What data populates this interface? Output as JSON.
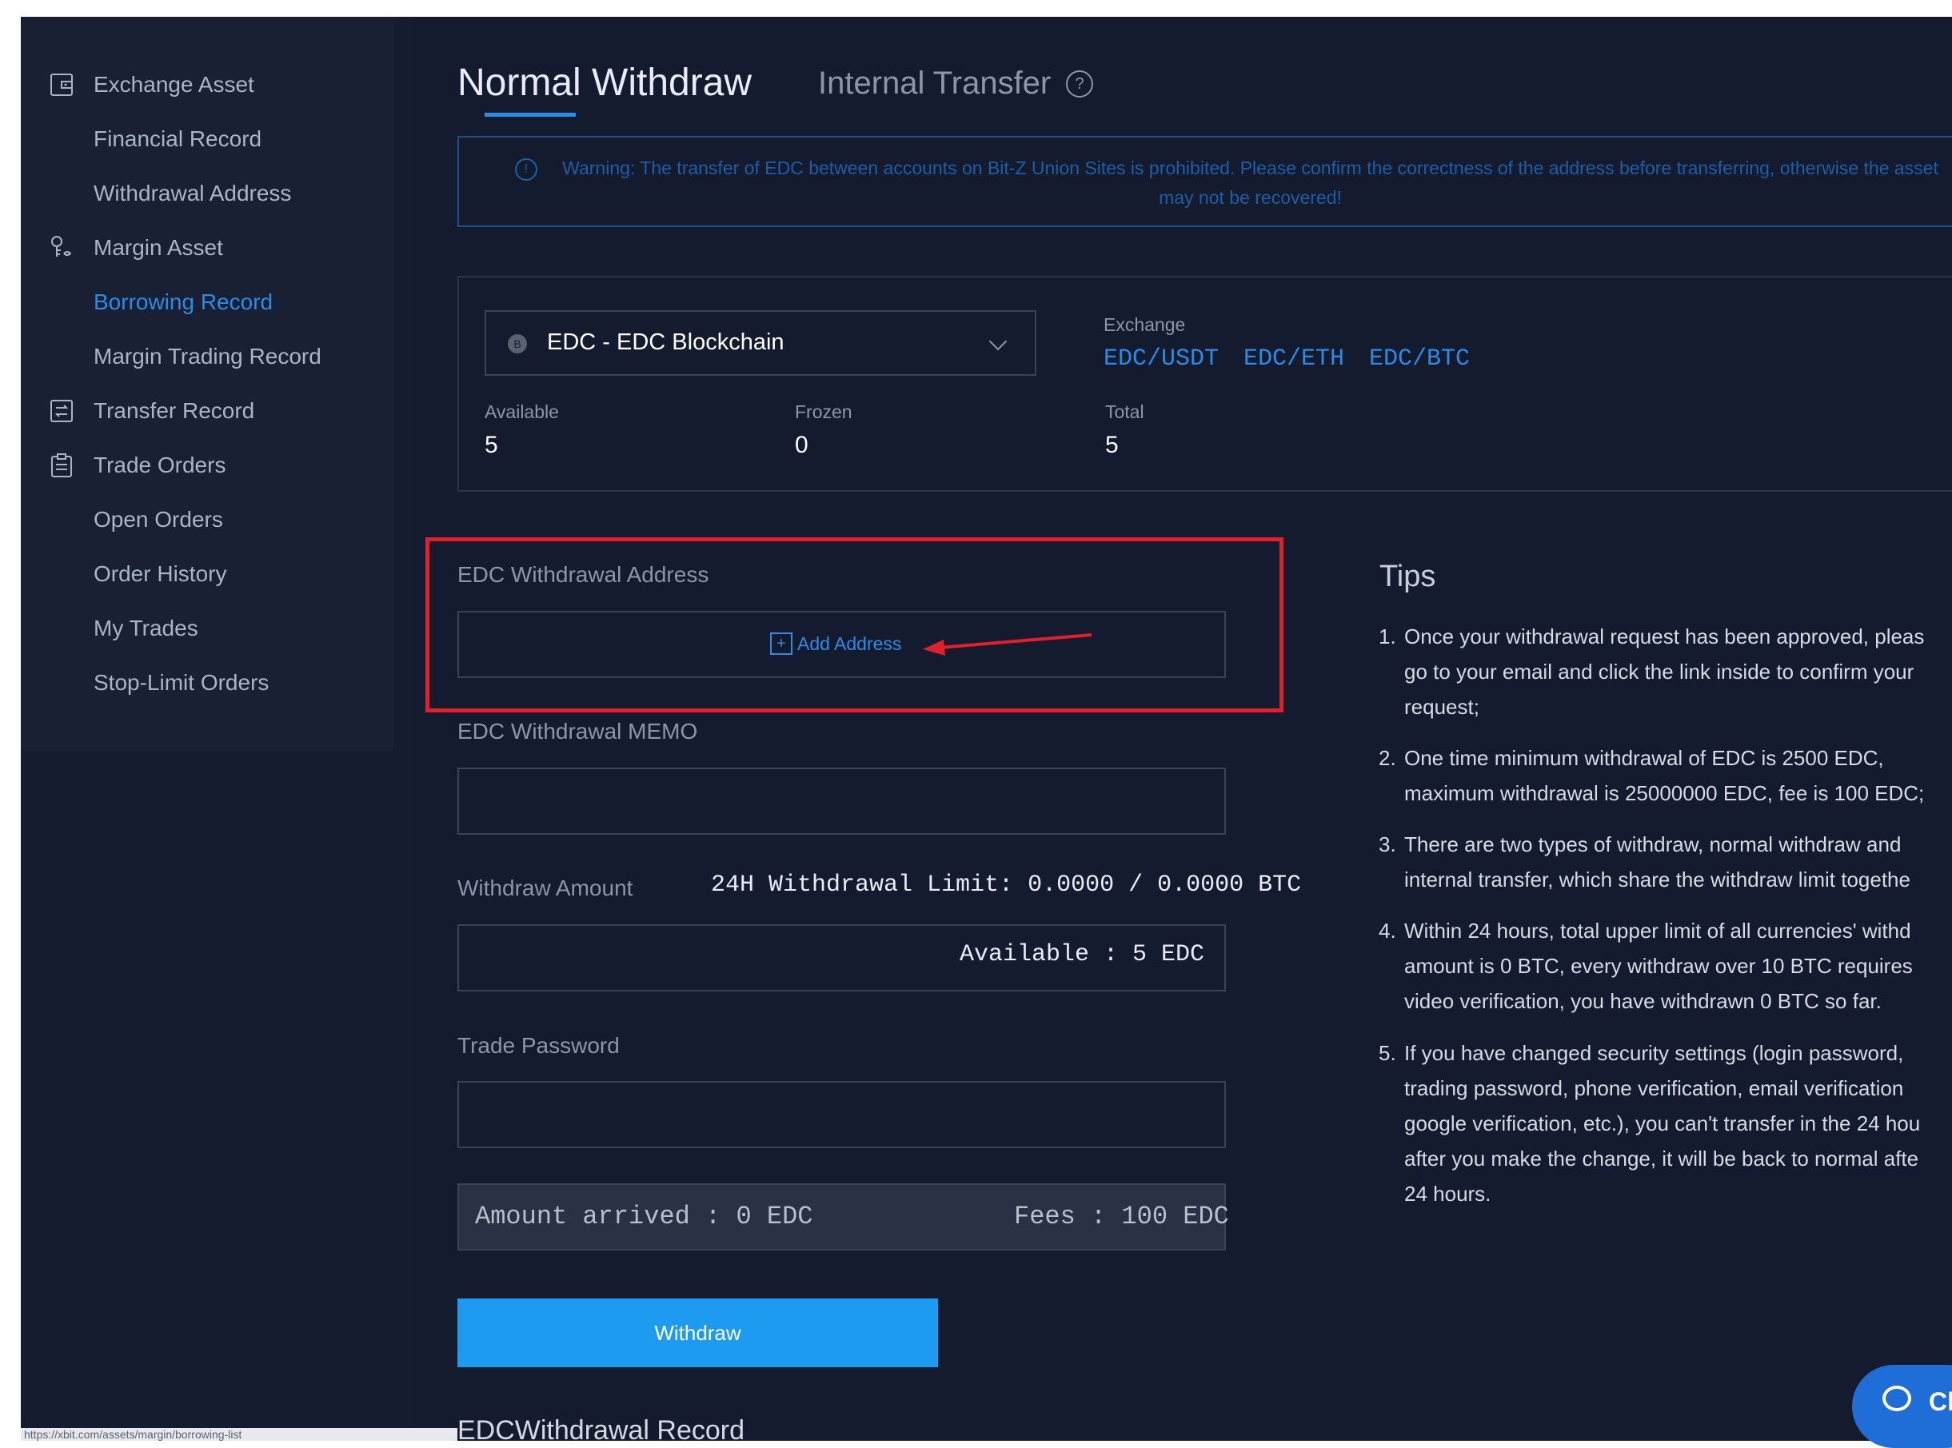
{
  "sidebar": {
    "items": [
      {
        "label": "Exchange Asset",
        "icon": "wallet-icon",
        "active": false
      },
      {
        "label": "Financial Record",
        "icon": "",
        "active": false
      },
      {
        "label": "Withdrawal Address",
        "icon": "",
        "active": false
      },
      {
        "label": "Margin Asset",
        "icon": "margin-icon",
        "active": false
      },
      {
        "label": "Borrowing Record",
        "icon": "",
        "active": true
      },
      {
        "label": "Margin Trading Record",
        "icon": "",
        "active": false
      },
      {
        "label": "Transfer Record",
        "icon": "transfer-icon",
        "active": false
      },
      {
        "label": "Trade Orders",
        "icon": "clipboard-icon",
        "active": false
      },
      {
        "label": "Open Orders",
        "icon": "",
        "active": false
      },
      {
        "label": "Order History",
        "icon": "",
        "active": false
      },
      {
        "label": "My Trades",
        "icon": "",
        "active": false
      },
      {
        "label": "Stop-Limit Orders",
        "icon": "",
        "active": false
      }
    ]
  },
  "tabs": {
    "normal": "Normal Withdraw",
    "internal": "Internal Transfer",
    "help_glyph": "?"
  },
  "warning": {
    "glyph": "!",
    "text": "Warning: The transfer of EDC between accounts on Bit-Z Union Sites is prohibited. Please confirm the correctness of the address before transferring, otherwise the asset may not be recovered!"
  },
  "asset": {
    "coin_glyph": "B",
    "coin": "EDC - EDC Blockchain",
    "exchange_label": "Exchange",
    "pairs": [
      "EDC/USDT",
      "EDC/ETH",
      "EDC/BTC"
    ],
    "available_label": "Available",
    "available_value": "5",
    "frozen_label": "Frozen",
    "frozen_value": "0",
    "total_label": "Total",
    "total_value": "5"
  },
  "form": {
    "address_label": "EDC Withdrawal Address",
    "add_icon_glyph": "+",
    "add_address": "Add Address",
    "memo_label": "EDC Withdrawal MEMO",
    "amount_label": "Withdraw Amount",
    "limit_text": "24H Withdrawal Limit: 0.0000 / 0.0000 BTC",
    "available_text": "Available : 5  EDC",
    "password_label": "Trade Password",
    "arrived_text": "Amount arrived : 0  EDC",
    "fees_text": "Fees : 100  EDC",
    "withdraw_button": "Withdraw",
    "record_title": "EDCWithdrawal Record"
  },
  "tips": {
    "title": "Tips",
    "items": [
      {
        "num": "1.",
        "lines": [
          "Once your withdrawal request has been approved, pleas",
          "go to your email and click the link inside to confirm your",
          "request;"
        ]
      },
      {
        "num": "2.",
        "lines": [
          "One time minimum withdrawal of EDC is 2500 EDC,",
          "maximum withdrawal is 25000000 EDC, fee is 100 EDC;"
        ]
      },
      {
        "num": "3.",
        "lines": [
          "There are two types of withdraw, normal withdraw and",
          "internal transfer, which share the withdraw limit togethe"
        ]
      },
      {
        "num": "4.",
        "lines": [
          "Within 24 hours, total upper limit of all currencies' withd",
          "amount is 0 BTC, every withdraw over 10 BTC requires",
          "video verification, you have withdrawn 0 BTC so far."
        ]
      },
      {
        "num": "5.",
        "lines": [
          "If you have changed security settings (login password,",
          "trading password, phone verification, email verification",
          "google verification, etc.), you can't transfer in the 24 hou",
          "after you make the change, it will be back to normal afte",
          "24 hours."
        ]
      }
    ]
  },
  "chat": {
    "label": "Cl"
  },
  "status_bar": {
    "url": "https://xbit.com/assets/margin/borrowing-list"
  },
  "colors": {
    "accent": "#2b8ce6",
    "button": "#1c9bf0",
    "highlight": "#e1202c",
    "background": "#141b2f"
  }
}
